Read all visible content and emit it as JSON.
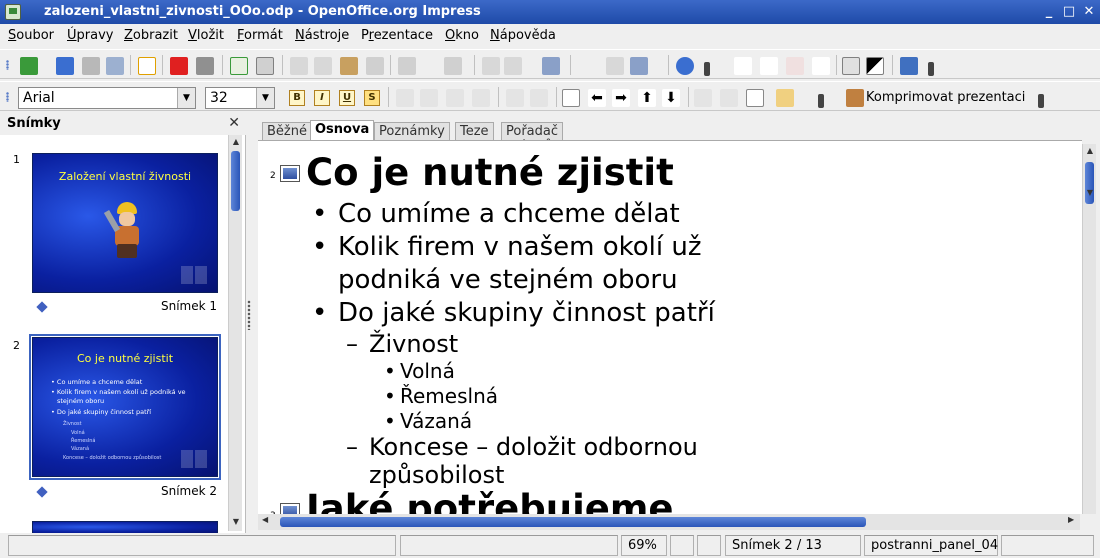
{
  "window": {
    "title": "zalozeni_vlastni_zivnosti_OOo.odp - OpenOffice.org Impress"
  },
  "menu": [
    {
      "key": "S",
      "rest": "oubor"
    },
    {
      "key": "Ú",
      "rest": "pravy"
    },
    {
      "key": "Z",
      "rest": "obrazit"
    },
    {
      "key": "V",
      "rest": "ložit",
      "pre": ""
    },
    {
      "key": "F",
      "rest": "ormát"
    },
    {
      "key": "N",
      "rest": "ástroje"
    },
    {
      "key": "r",
      "rest": "ezentace",
      "pre": "P"
    },
    {
      "key": "O",
      "rest": "kno"
    },
    {
      "key": "N",
      "rest": "ápověda"
    }
  ],
  "format_toolbar": {
    "font_name": "Arial",
    "font_size": "32",
    "bold": "B",
    "italic": "I",
    "underline": "U",
    "shadow": "S",
    "compress_label": "Komprimovat prezentaci"
  },
  "slides_pane": {
    "title": "Snímky",
    "slides": [
      {
        "number": "1",
        "label": "Snímek 1",
        "title": "Založení vlastní živnosti"
      },
      {
        "number": "2",
        "label": "Snímek 2",
        "title": "Co je nutné zjistit",
        "bullets": [
          "Co umíme a chceme dělat",
          "Kolik firem v našem okolí už podniká ve",
          "stejném oboru",
          "Do jaké skupiny činnost patří"
        ],
        "sub": [
          "Živnost",
          "Volná",
          "Řemeslná",
          "Vázaná",
          "Koncese – doložit odbornou způsobilost"
        ]
      }
    ]
  },
  "view_tabs": [
    "Běžné",
    "Osnova",
    "Poznámky",
    "Teze",
    "Pořadač snímků"
  ],
  "active_tab": "Osnova",
  "outline": {
    "slide2_num": "2",
    "slide2_title": "Co je nutné zjistit",
    "l2_1": "Co umíme a chceme dělat",
    "l2_2a": "Kolik firem v našem okolí už",
    "l2_2b": "podniká ve stejném oboru",
    "l2_3": "Do jaké skupiny  činnost patří",
    "l3_1": "Živnost",
    "l4_1": "Volná",
    "l4_2": "Řemeslná",
    "l4_3": "Vázaná",
    "l3_2a": "Koncese – doložit odbornou",
    "l3_2b": "způsobilost",
    "slide3_num": "3",
    "slide3_title": "Jaké potřebujeme"
  },
  "status": {
    "zoom": "69%",
    "slide": "Snímek 2 / 13",
    "layout": "postranni_panel_04"
  }
}
